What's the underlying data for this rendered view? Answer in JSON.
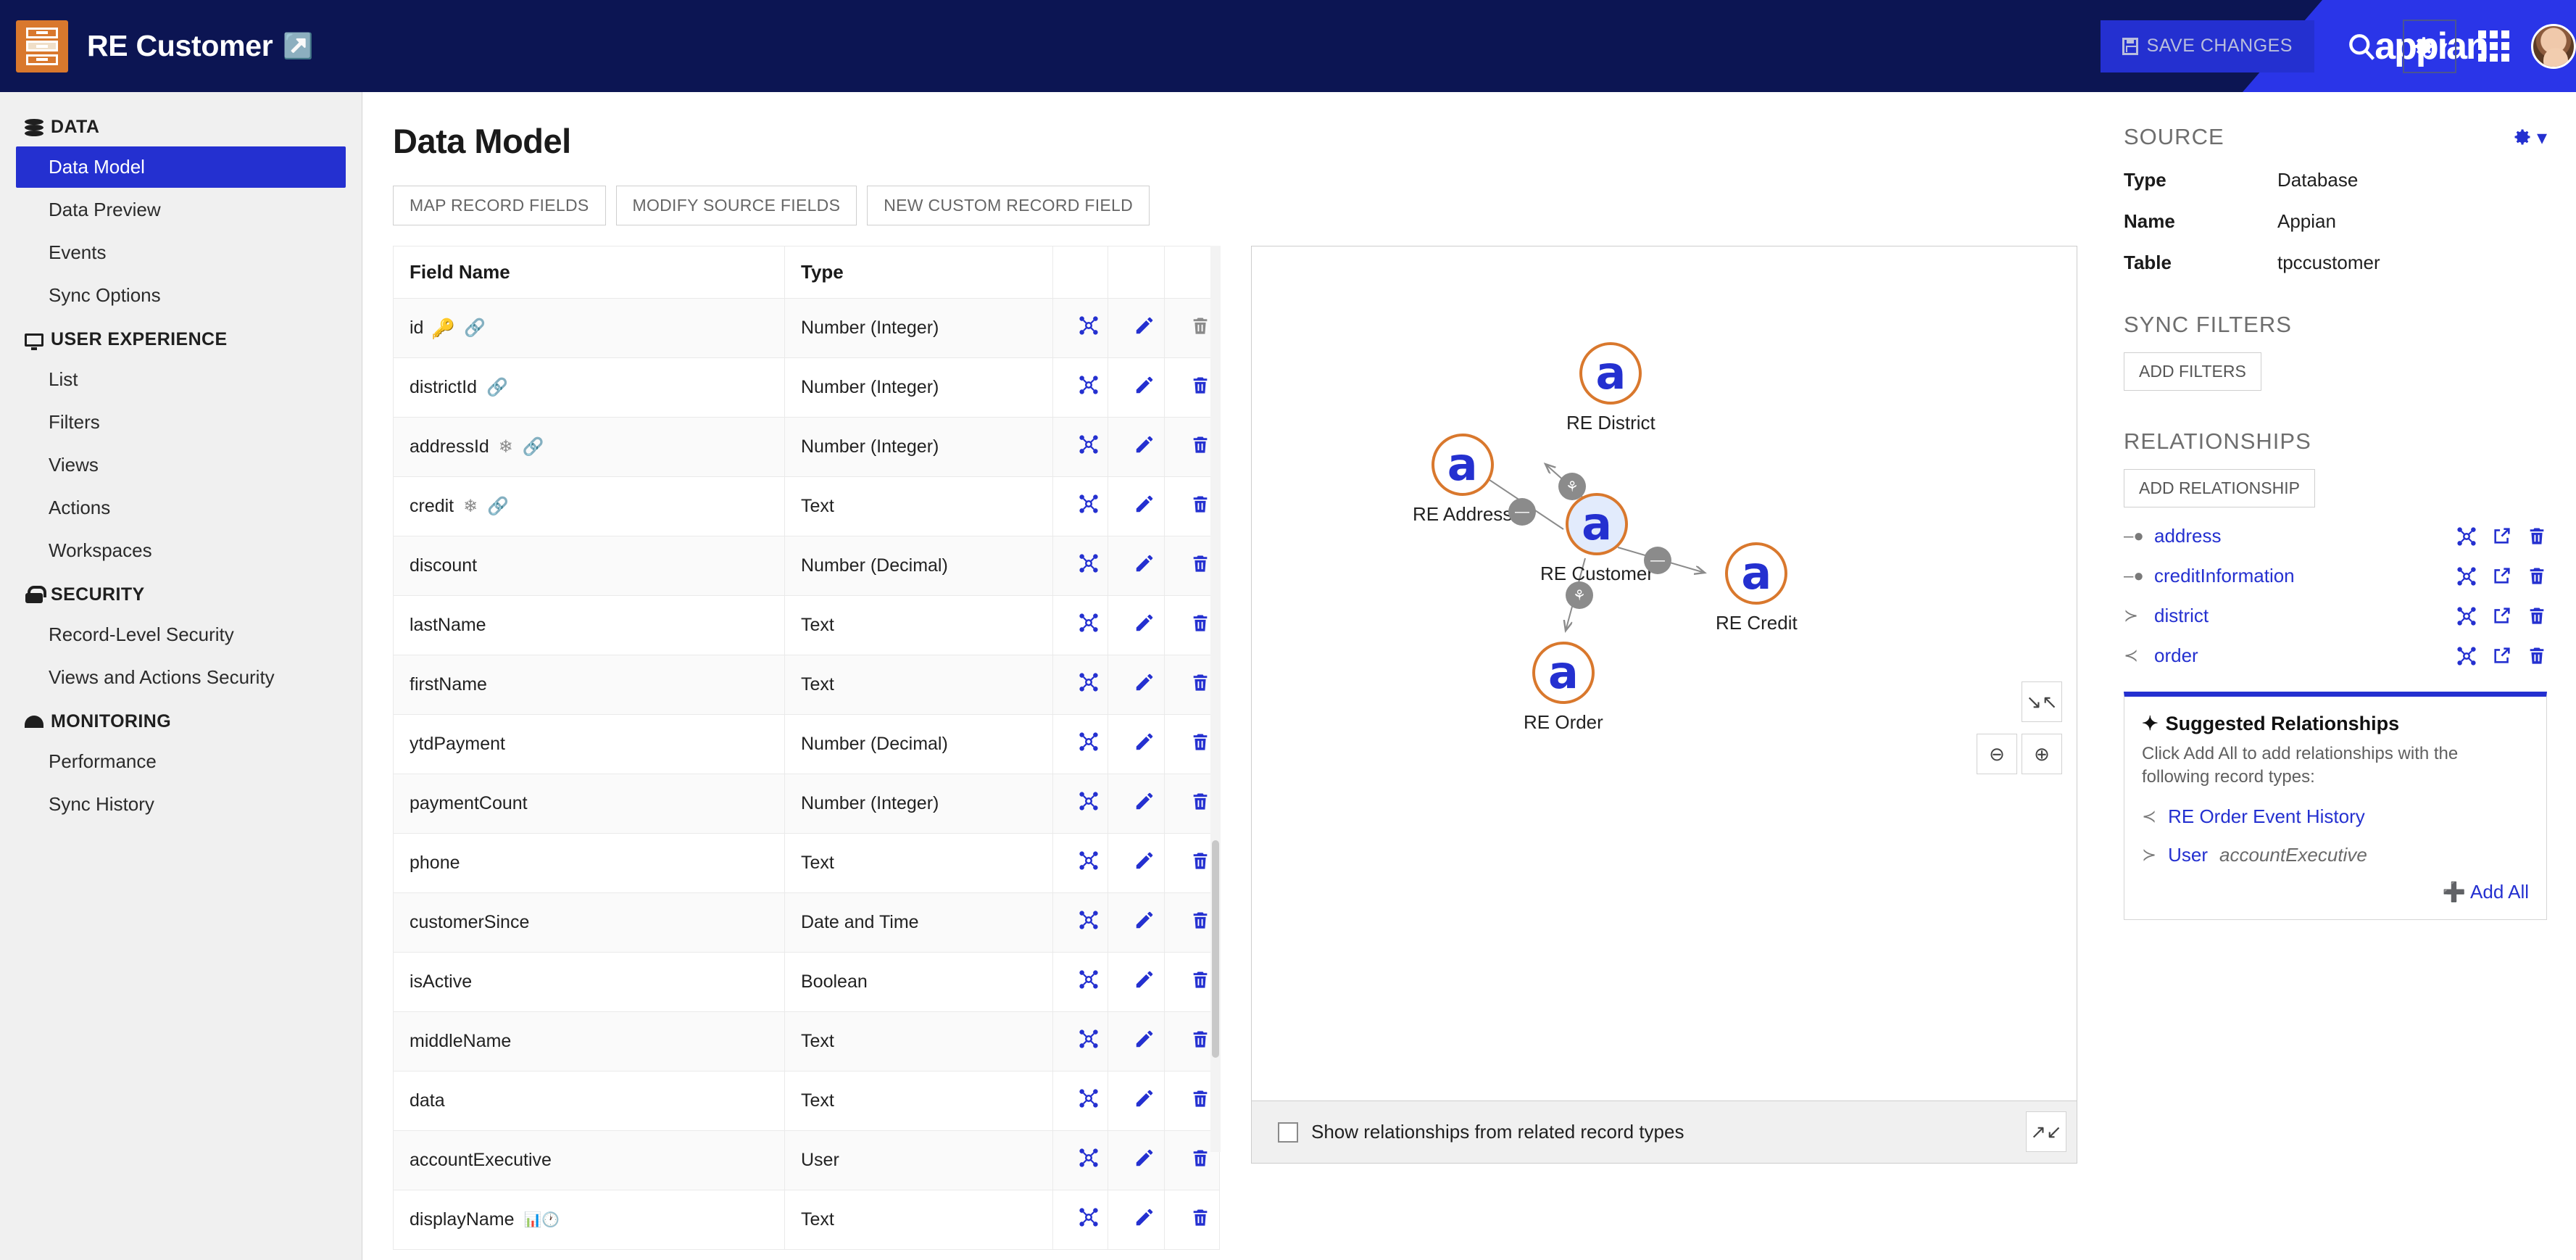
{
  "topbar": {
    "app_title": "RE Customer",
    "external_link_icon": "external-link-icon",
    "save_label": "SAVE CHANGES",
    "brand": "appian",
    "search_icon": "search-icon",
    "gear_icon": "gear-icon",
    "apps_icon": "apps-grid-icon",
    "avatar_icon": "user-avatar",
    "colors": {
      "bar": "#0c1553",
      "accent": "#2430d0",
      "brand_wedge": "#2a35e8",
      "app_icon": "#d9782d"
    }
  },
  "sidebar": {
    "groups": [
      {
        "label": "DATA",
        "icon": "database-icon",
        "items": [
          {
            "label": "Data Model",
            "active": true
          },
          {
            "label": "Data Preview",
            "active": false
          },
          {
            "label": "Events",
            "active": false
          },
          {
            "label": "Sync Options",
            "active": false
          }
        ]
      },
      {
        "label": "USER EXPERIENCE",
        "icon": "monitor-icon",
        "items": [
          {
            "label": "List",
            "active": false
          },
          {
            "label": "Filters",
            "active": false
          },
          {
            "label": "Views",
            "active": false
          },
          {
            "label": "Actions",
            "active": false
          },
          {
            "label": "Workspaces",
            "active": false
          }
        ]
      },
      {
        "label": "SECURITY",
        "icon": "lock-icon",
        "items": [
          {
            "label": "Record-Level Security",
            "active": false
          },
          {
            "label": "Views and Actions Security",
            "active": false
          }
        ]
      },
      {
        "label": "MONITORING",
        "icon": "gauge-icon",
        "items": [
          {
            "label": "Performance",
            "active": false
          },
          {
            "label": "Sync History",
            "active": false
          }
        ]
      }
    ]
  },
  "main": {
    "page_title": "Data Model",
    "buttons": [
      {
        "label": "MAP RECORD FIELDS"
      },
      {
        "label": "MODIFY SOURCE FIELDS"
      },
      {
        "label": "NEW CUSTOM RECORD FIELD"
      }
    ],
    "table": {
      "headers": [
        "Field Name",
        "Type",
        "",
        "",
        ""
      ],
      "rows": [
        {
          "name": "id",
          "type": "Number (Integer)",
          "badges": [
            "primary-key-icon",
            "link-icon"
          ],
          "delete_enabled": false
        },
        {
          "name": "districtId",
          "type": "Number (Integer)",
          "badges": [
            "link-icon"
          ],
          "delete_enabled": true
        },
        {
          "name": "addressId",
          "type": "Number (Integer)",
          "badges": [
            "snowflake-icon",
            "link-icon"
          ],
          "delete_enabled": true
        },
        {
          "name": "credit",
          "type": "Text",
          "badges": [
            "snowflake-icon",
            "link-icon"
          ],
          "delete_enabled": true
        },
        {
          "name": "discount",
          "type": "Number (Decimal)",
          "badges": [],
          "delete_enabled": true
        },
        {
          "name": "lastName",
          "type": "Text",
          "badges": [],
          "delete_enabled": true
        },
        {
          "name": "firstName",
          "type": "Text",
          "badges": [],
          "delete_enabled": true
        },
        {
          "name": "ytdPayment",
          "type": "Number (Decimal)",
          "badges": [],
          "delete_enabled": true
        },
        {
          "name": "paymentCount",
          "type": "Number (Integer)",
          "badges": [],
          "delete_enabled": true
        },
        {
          "name": "phone",
          "type": "Text",
          "badges": [],
          "delete_enabled": true
        },
        {
          "name": "customerSince",
          "type": "Date and Time",
          "badges": [],
          "delete_enabled": true
        },
        {
          "name": "isActive",
          "type": "Boolean",
          "badges": [],
          "delete_enabled": true
        },
        {
          "name": "middleName",
          "type": "Text",
          "badges": [],
          "delete_enabled": true
        },
        {
          "name": "data",
          "type": "Text",
          "badges": [],
          "delete_enabled": true
        },
        {
          "name": "accountExecutive",
          "type": "User",
          "badges": [],
          "delete_enabled": true
        },
        {
          "name": "displayName",
          "type": "Text",
          "badges": [
            "calculated-field-icon"
          ],
          "delete_enabled": true
        }
      ],
      "row_action_icons": [
        "relationship-graph-icon",
        "edit-pencil-icon",
        "delete-trash-icon"
      ]
    },
    "diagram": {
      "nodes": [
        {
          "id": "district",
          "label": "RE District",
          "center": false
        },
        {
          "id": "address",
          "label": "RE Address",
          "center": false
        },
        {
          "id": "customer",
          "label": "RE Customer",
          "center": true
        },
        {
          "id": "credit",
          "label": "RE Credit",
          "center": false
        },
        {
          "id": "order",
          "label": "RE Order",
          "center": false
        }
      ],
      "edges": [
        {
          "from": "customer",
          "to": "district",
          "kind": "many-to-one"
        },
        {
          "from": "customer",
          "to": "address",
          "kind": "one-to-one"
        },
        {
          "from": "customer",
          "to": "credit",
          "kind": "one-to-one"
        },
        {
          "from": "customer",
          "to": "order",
          "kind": "one-to-many"
        }
      ],
      "controls": [
        "collapse-icon",
        "zoom-out-icon",
        "zoom-in-icon",
        "expand-icon"
      ],
      "checkbox_label": "Show relationships from related record types",
      "checkbox_checked": false
    }
  },
  "right_panel": {
    "source_title": "SOURCE",
    "gear_icon": "gear-dropdown-icon",
    "source_fields": [
      {
        "key": "Type",
        "value": "Database"
      },
      {
        "key": "Name",
        "value": "Appian"
      },
      {
        "key": "Table",
        "value": "tpccustomer"
      }
    ],
    "sync_filters_title": "SYNC FILTERS",
    "add_filters_label": "ADD FILTERS",
    "relationships_title": "RELATIONSHIPS",
    "add_relationship_label": "ADD RELATIONSHIP",
    "relationships": [
      {
        "name": "address",
        "kind": "one-to-one-icon"
      },
      {
        "name": "creditInformation",
        "kind": "one-to-one-icon"
      },
      {
        "name": "district",
        "kind": "many-to-one-icon"
      },
      {
        "name": "order",
        "kind": "one-to-many-icon"
      }
    ],
    "relationship_action_icons": [
      "relationship-graph-icon",
      "open-external-icon",
      "delete-trash-icon"
    ],
    "suggested": {
      "title": "Suggested Relationships",
      "sparkle_icon": "sparkle-icon",
      "description": "Click Add All to add relationships with the following record types:",
      "items": [
        {
          "name": "RE Order Event History",
          "sub": "",
          "kind": "one-to-many-icon"
        },
        {
          "name": "User",
          "sub": "accountExecutive",
          "kind": "many-to-one-icon"
        }
      ],
      "add_all_label": "Add All"
    }
  }
}
